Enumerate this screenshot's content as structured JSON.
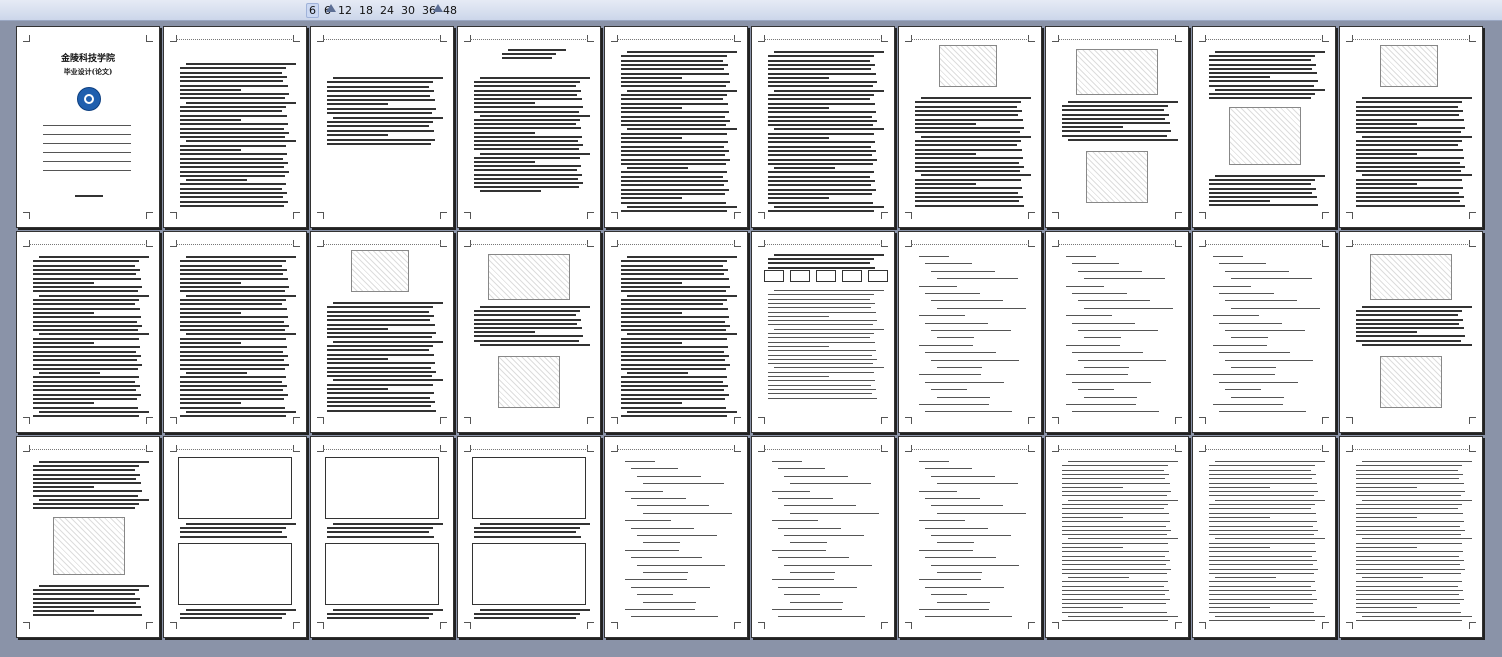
{
  "zoom_levels": [
    "6",
    "6",
    "12",
    "18",
    "24",
    "30",
    "36",
    "48"
  ],
  "zoom_active_index": 0,
  "cover": {
    "school": "金陵科技学院",
    "subtitle": "毕业设计(论文)"
  },
  "colors": {
    "background": "#8a93a8",
    "toolbar": "#dde4f2",
    "logo": "#1f5fae"
  },
  "pages": [
    "cover",
    "toc",
    "abstract-cn",
    "abstract-en",
    "text",
    "text",
    "figure",
    "figure",
    "figure",
    "figure",
    "text",
    "text",
    "figure",
    "figure",
    "text",
    "diagram",
    "formula",
    "formula",
    "formula",
    "figure",
    "figure",
    "table",
    "table",
    "table",
    "formula",
    "formula",
    "formula",
    "text",
    "text",
    "text"
  ]
}
